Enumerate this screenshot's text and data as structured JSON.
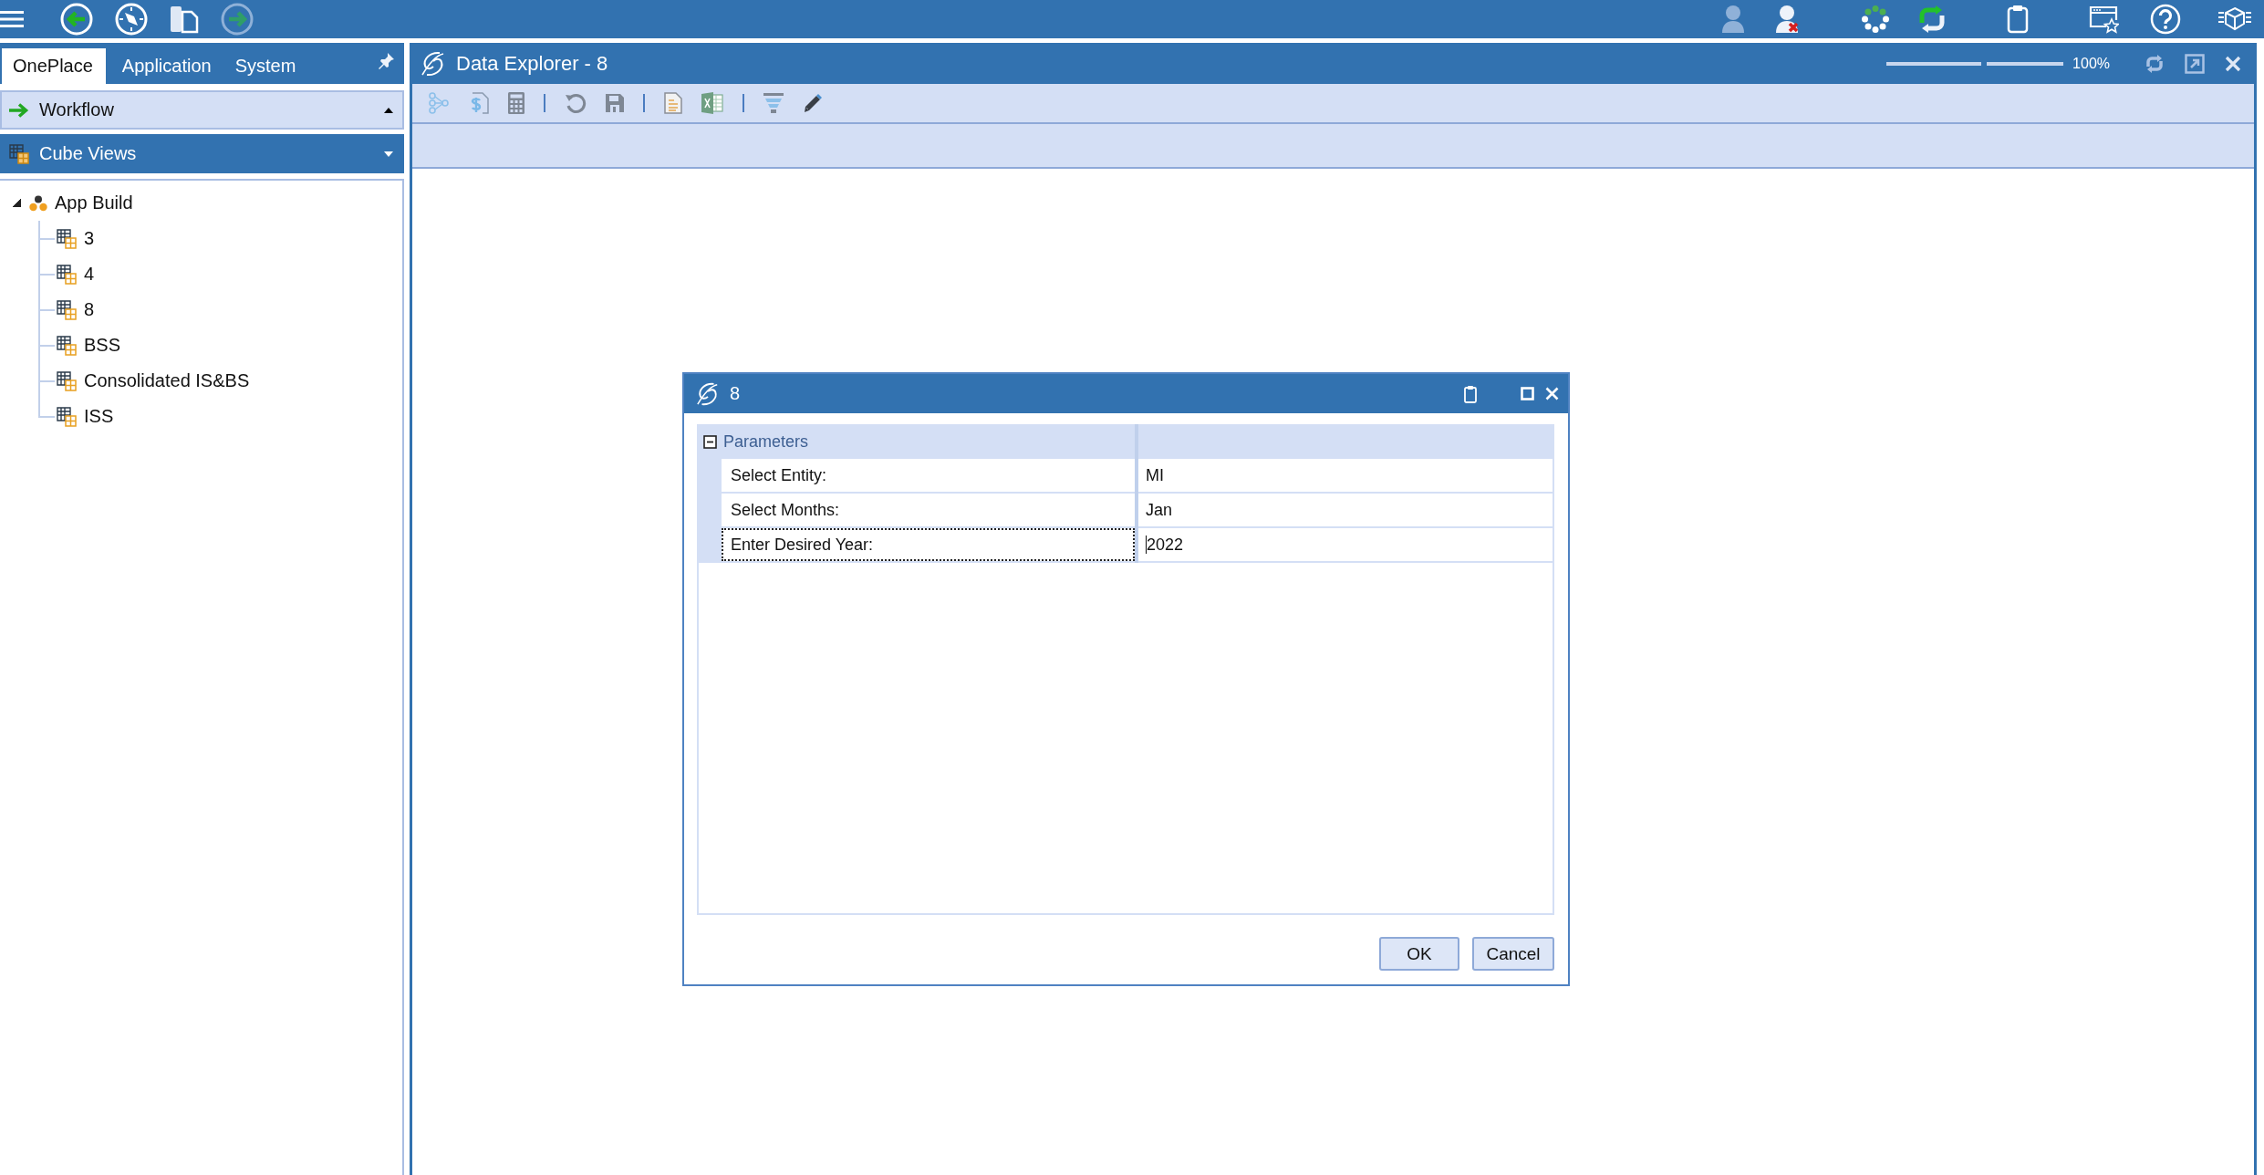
{
  "left_panel": {
    "tabs": [
      {
        "label": "OnePlace",
        "selected": true
      },
      {
        "label": "Application",
        "selected": false
      },
      {
        "label": "System",
        "selected": false
      }
    ],
    "sections": [
      {
        "kind": "workflow",
        "title": "Workflow",
        "expanded": false
      },
      {
        "kind": "cube_views",
        "title": "Cube Views",
        "expanded": true,
        "tree": [
          {
            "kind": "group",
            "label": "App Build",
            "expanded": true,
            "children": [
              {
                "kind": "cube_view",
                "label": "3"
              },
              {
                "kind": "cube_view",
                "label": "4"
              },
              {
                "kind": "cube_view",
                "label": "8"
              },
              {
                "kind": "cube_view",
                "label": "BSS"
              },
              {
                "kind": "cube_view",
                "label": "Consolidated IS&BS"
              },
              {
                "kind": "cube_view",
                "label": "ISS"
              }
            ]
          }
        ]
      }
    ]
  },
  "document": {
    "title": "Data Explorer - 8",
    "zoom": {
      "level": 0.55,
      "reading": "100%"
    }
  },
  "dialog": {
    "title": "8",
    "group": {
      "title": "Parameters",
      "expanded": true,
      "rows": [
        {
          "label": "Select Entity:",
          "value": "MI",
          "focused": false
        },
        {
          "label": "Select Months:",
          "value": "Jan",
          "focused": false
        },
        {
          "label": "Enter Desired Year:",
          "value": "2022",
          "focused": true
        }
      ]
    },
    "buttons": [
      "OK",
      "Cancel"
    ]
  }
}
